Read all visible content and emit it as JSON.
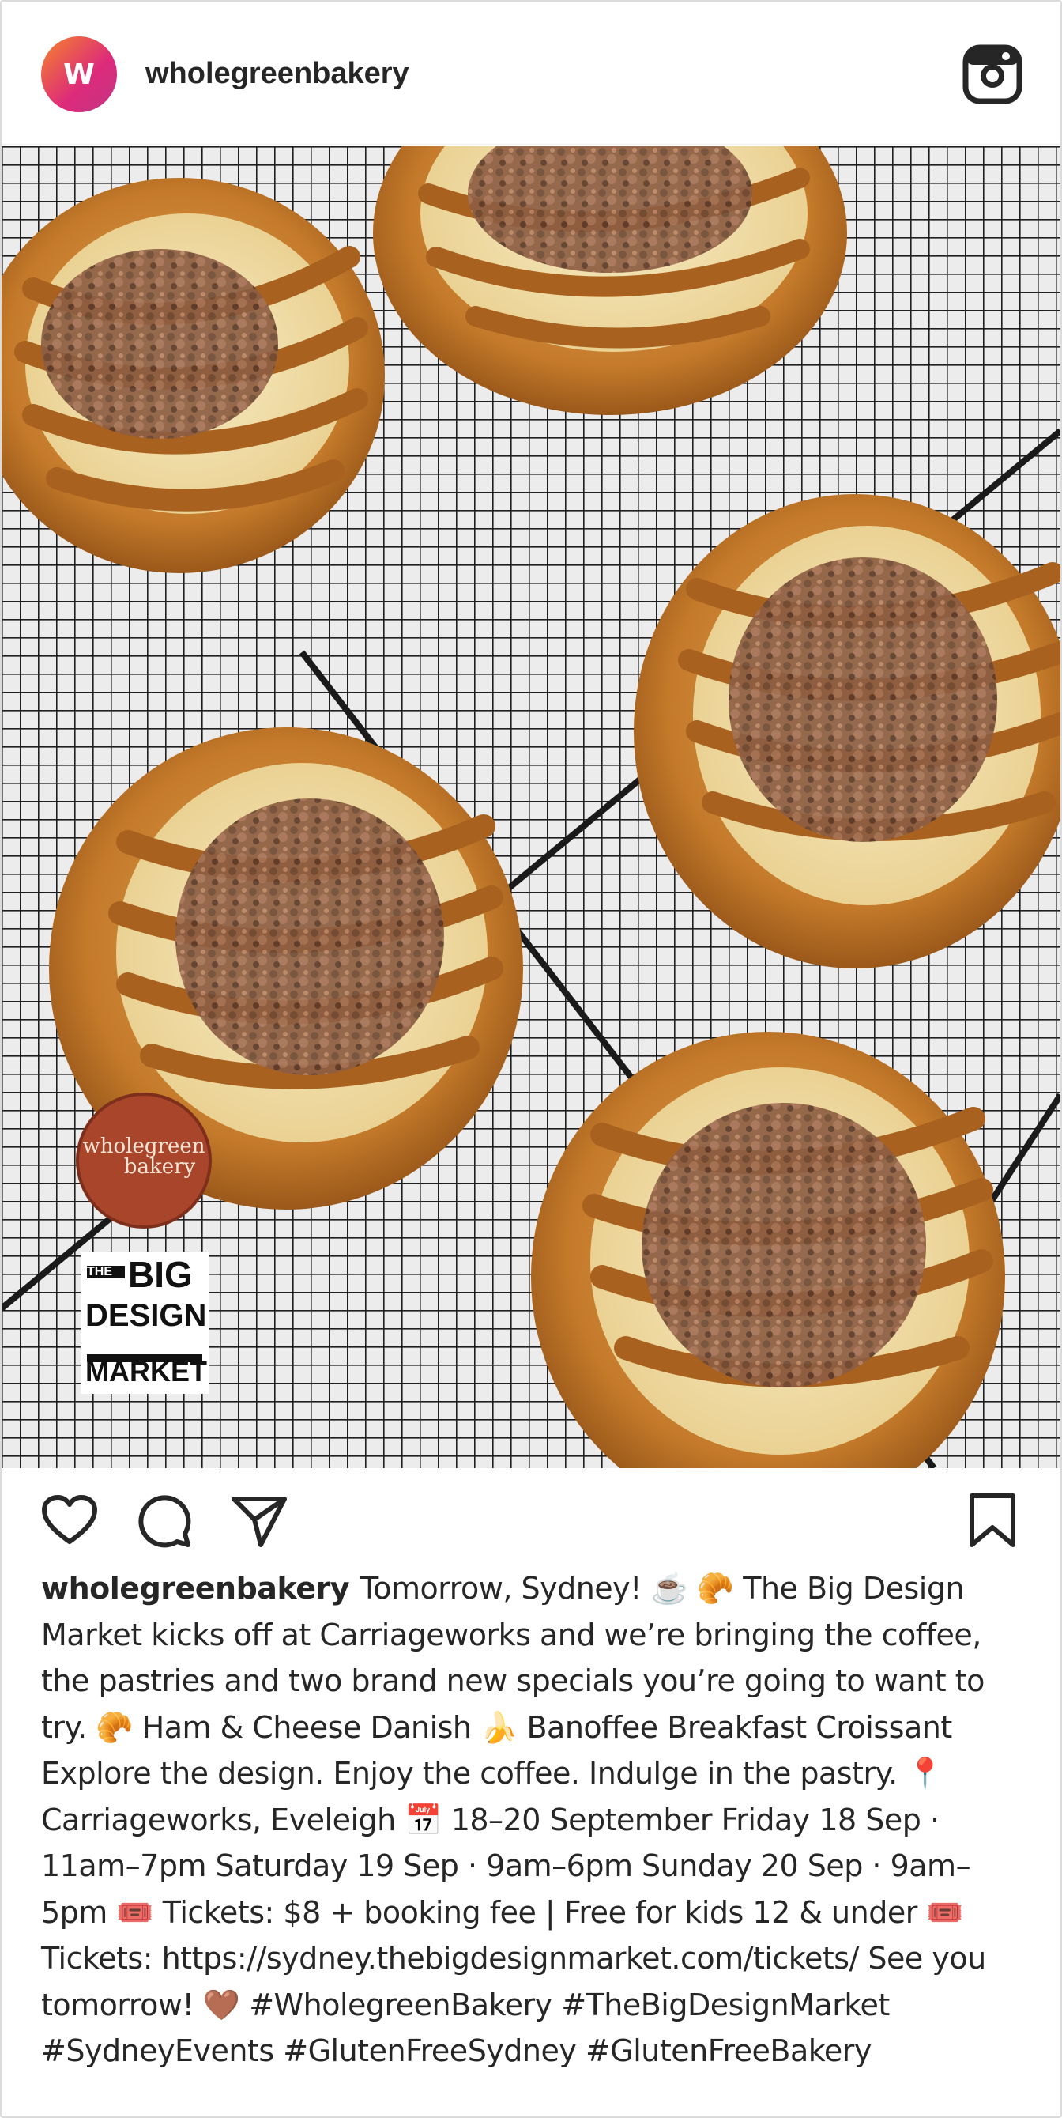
{
  "post": {
    "username": "wholegreenbakery",
    "avatar_letter": "W",
    "caption_username": "wholegreenbakery",
    "caption_text": "Tomorrow, Sydney! ☕️ 🥐 The Big Design Market kicks off at Carriageworks and we’re bringing the coffee, the pastries and two brand new specials you’re going to want to try. 🥐 Ham & Cheese Danish 🍌 Banoffee Breakfast Croissant Explore the design. Enjoy the coffee. Indulge in the pastry. 📍 Carriageworks, Eveleigh 📅 18–20 September Friday 18 Sep · 11am–7pm Saturday 19 Sep · 9am–6pm Sunday 20 Sep · 9am–5pm 🎟️ Tickets: $8 + booking fee | Free for kids 12 & under 🎟️ Tickets: https://sydney.thebigdesignmarket.com/tickets/ See you tomorrow! 🤎 #WholegreenBakery #TheBigDesignMarket #SydneyEvents #GlutenFreeSydney #GlutenFreeBakery"
  },
  "photo": {
    "logo_text_line1": "wholegreen",
    "logo_text_line2": "bakery",
    "badge_line1": "THE",
    "badge_line2": "BIG",
    "badge_line3": "DESIGN",
    "badge_line4": "MARKET"
  },
  "icons": {
    "like": "heart-icon",
    "comment": "comment-icon",
    "share": "paper-plane-icon",
    "save": "bookmark-icon",
    "brand": "instagram-icon"
  },
  "colors": {
    "text": "#262626",
    "border": "#dbdbdb",
    "avatar_start": "#f58529",
    "avatar_end": "#c13584",
    "pastry": "#c9812e",
    "caramel": "#a8611f",
    "cream": "#f3e3b6",
    "crumble": "#6f4a36",
    "rack": "#1f1f1f",
    "marble": "#e9e9e9"
  }
}
